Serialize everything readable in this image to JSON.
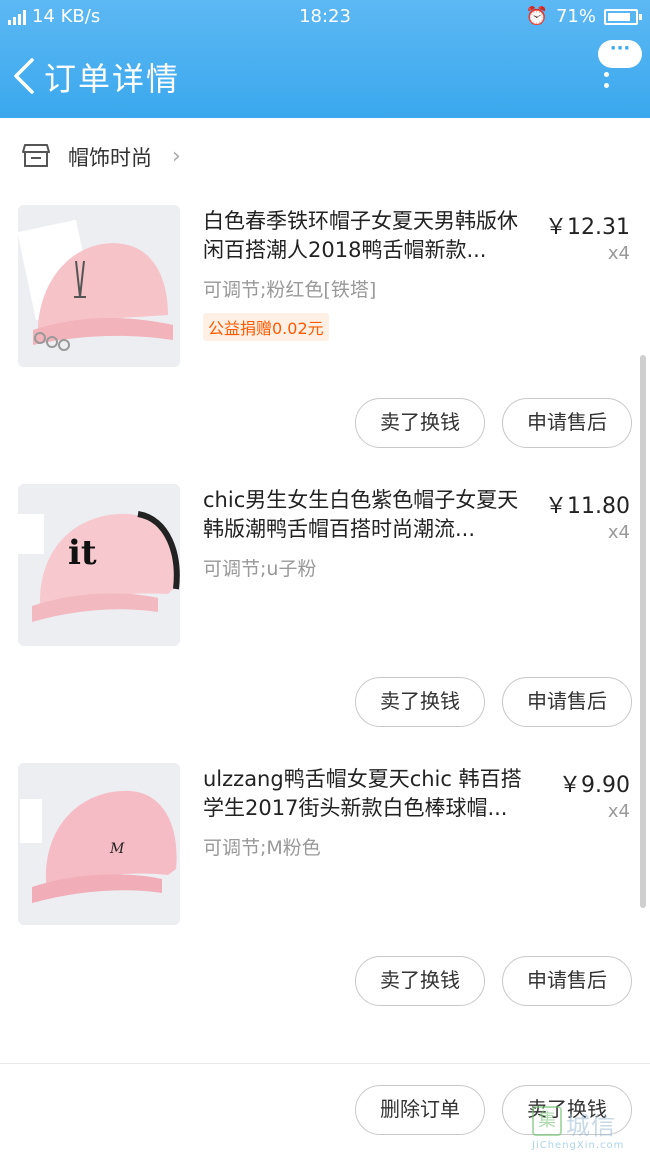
{
  "status_bar": {
    "network": "4G",
    "speed": "14 KB/s",
    "time": "18:23",
    "battery": "71%"
  },
  "header": {
    "title": "订单详情",
    "more_label": "···"
  },
  "shop": {
    "name": "帽饰时尚"
  },
  "items": [
    {
      "name": "白色春季铁环帽子女夏天男韩版休闲百搭潮人2018鸭舌帽新款...",
      "price": "￥12.31",
      "qty": "x4",
      "spec": "可调节;粉红色[铁塔]",
      "promo": "公益捐赠0.02元",
      "sell_label": "卖了换钱",
      "aftersale_label": "申请售后"
    },
    {
      "name": "chic男生女生白色紫色帽子女夏天韩版潮鸭舌帽百搭时尚潮流...",
      "price": "￥11.80",
      "qty": "x4",
      "spec": "可调节;u子粉",
      "sell_label": "卖了换钱",
      "aftersale_label": "申请售后"
    },
    {
      "name": "ulzzang鸭舌帽女夏天chic 韩百搭学生2017街头新款白色棒球帽...",
      "price": "￥9.90",
      "qty": "x4",
      "spec": "可调节;M粉色",
      "sell_label": "卖了换钱",
      "aftersale_label": "申请售后"
    }
  ],
  "footer": {
    "delete_label": "删除订单",
    "sell_label": "卖了换钱"
  },
  "watermark": {
    "text": "城信",
    "url": "JiChengXin.com"
  },
  "colors": {
    "header": "#3aa8ee",
    "promo": "#ff5a00",
    "cap_pink": "#f7c6cc"
  }
}
